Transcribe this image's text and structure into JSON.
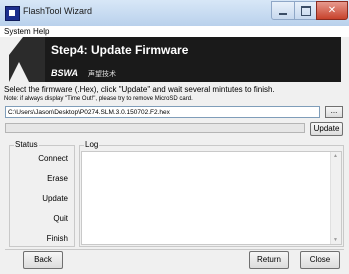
{
  "window": {
    "title": "FlashTool Wizard",
    "close_glyph": "✕"
  },
  "menu": {
    "items": [
      "System",
      "Help"
    ]
  },
  "banner": {
    "title": "Step4: Update Firmware",
    "logo": "BSWA",
    "logo_cn": "声望技术"
  },
  "instructions": {
    "main": "Select the firmware (.Hex), click \"Update\" and wait several mintutes to finish.",
    "note": "Note: if always display \"Time Out!\", please try to remove MicroSD card."
  },
  "file": {
    "path": "C:\\Users\\Jason\\Desktop\\P0274.SLM.3.0.150702.F2.hex",
    "browse_label": "..."
  },
  "progress": {
    "value": 0
  },
  "buttons": {
    "update": "Update",
    "back": "Back",
    "return": "Return",
    "close": "Close"
  },
  "status_group": {
    "title": "Status",
    "items": [
      "Connect",
      "Erase",
      "Update",
      "Quit",
      "Finish"
    ]
  },
  "log_group": {
    "title": "Log",
    "content": ""
  },
  "icons": {
    "app": "flashtool-app-icon",
    "scroll_up": "scroll-up-arrow",
    "scroll_down": "scroll-down-arrow"
  },
  "colors": {
    "banner_bg": "#1a1a1a",
    "title_bar": "#c7d9ee",
    "close_button": "#c7422c"
  }
}
